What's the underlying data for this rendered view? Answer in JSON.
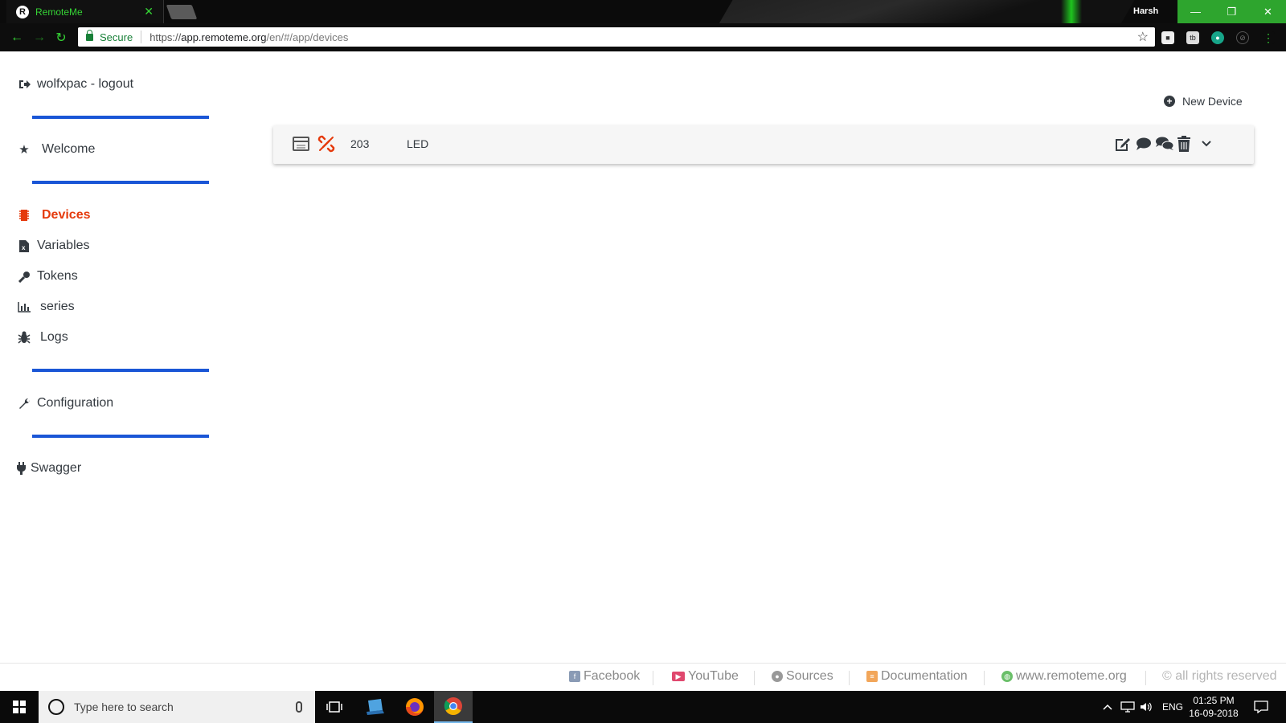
{
  "browser": {
    "tab_title": "RemoteMe",
    "tab_logo": "R",
    "profile": "Harsh",
    "secure_label": "Secure",
    "url_scheme": "https://",
    "url_host": "app.remoteme.org",
    "url_path": "/en/#/app/devices"
  },
  "sidebar": {
    "logout": "wolfxpac - logout",
    "welcome": "Welcome",
    "items": [
      {
        "label": "Devices",
        "icon": "chip-icon",
        "active": true
      },
      {
        "label": "Variables",
        "icon": "variable-file-icon"
      },
      {
        "label": "Tokens",
        "icon": "key-icon"
      },
      {
        "label": "series",
        "icon": "bar-chart-icon"
      },
      {
        "label": "Logs",
        "icon": "bug-icon"
      }
    ],
    "configuration": "Configuration",
    "swagger": "Swagger"
  },
  "main": {
    "new_device": "New Device",
    "devices": [
      {
        "id": "203",
        "name": "LED"
      }
    ]
  },
  "footer": {
    "facebook": "Facebook",
    "youtube": "YouTube",
    "sources": "Sources",
    "documentation": "Documentation",
    "website": "www.remoteme.org",
    "rights": "© all rights reserved"
  },
  "taskbar": {
    "search_placeholder": "Type here to search",
    "language": "ENG",
    "time": "01:25 PM",
    "date": "16-09-2018"
  },
  "colors": {
    "accent": "#1a56d6",
    "active": "#e53a0c",
    "chrome_green": "#35d435"
  }
}
